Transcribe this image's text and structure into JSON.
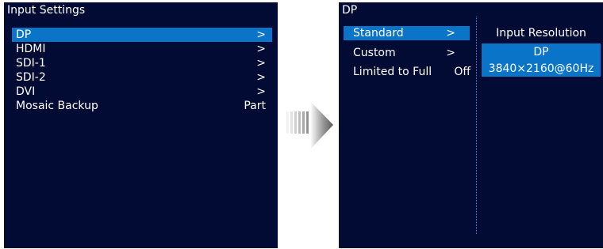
{
  "left_panel": {
    "title": "Input Settings",
    "items": [
      {
        "label": "DP",
        "arrow": ">"
      },
      {
        "label": "HDMI",
        "arrow": ">"
      },
      {
        "label": "SDI-1",
        "arrow": ">"
      },
      {
        "label": "SDI-2",
        "arrow": ">"
      },
      {
        "label": "DVI",
        "arrow": ">"
      },
      {
        "label": "Mosaic Backup",
        "value": "Part"
      }
    ],
    "selected_item": "DP"
  },
  "right_panel": {
    "title": "DP",
    "items": [
      {
        "label": "Standard",
        "arrow": ">"
      },
      {
        "label": "Custom",
        "arrow": ">"
      },
      {
        "label": "Limited to Full",
        "value": "Off"
      }
    ],
    "selected_item": "Standard",
    "submenu": {
      "header": "Input Resolution",
      "name": "DP",
      "resolution": "3840×2160@60Hz"
    }
  },
  "colors": {
    "screen_background": "#020b33",
    "highlight": "#0a75c8",
    "text": "#ffffff"
  },
  "icons": [
    "arrow-right-icon"
  ]
}
